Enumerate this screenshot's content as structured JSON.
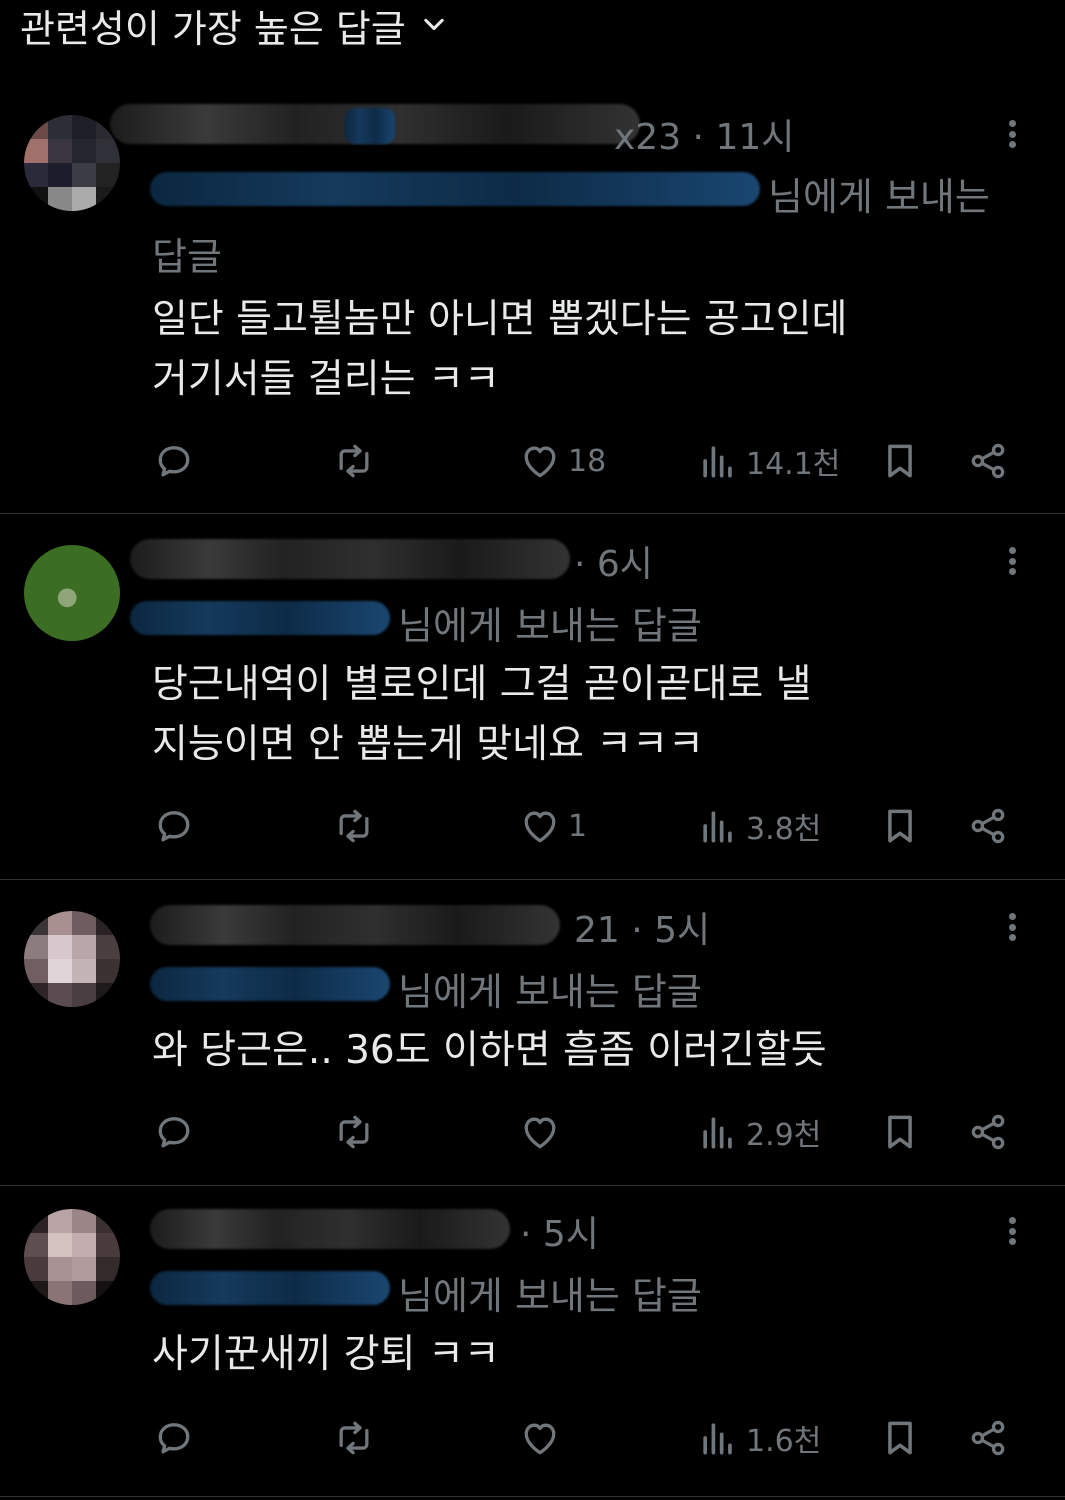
{
  "header": {
    "sort_label": "관련성이 가장 높은 답글"
  },
  "replies": [
    {
      "time_tail": "x23 · 11시",
      "replying_tail": "님에게 보내는",
      "replying_cont": "답글",
      "text_line1": "일단 들고튈놈만 아니면 뽑겠다는 공고인데",
      "text_line2": "거기서들 걸리는 ㅋㅋ",
      "likes": "18",
      "views": "14.1천"
    },
    {
      "time_tail": "· 6시",
      "replying_tail": "님에게 보내는 답글",
      "text_line1": "당근내역이 별로인데 그걸 곧이곧대로 낼",
      "text_line2": "지능이면 안 뽑는게 맞네요 ㅋㅋㅋ",
      "likes": "1",
      "views": "3.8천"
    },
    {
      "time_tail": "21 · 5시",
      "replying_tail": "님에게 보내는 답글",
      "text_line1": "와 당근은.. 36도 이하면 흠좀 이러긴할듯",
      "likes": "",
      "views": "2.9천"
    },
    {
      "time_tail": "· 5시",
      "replying_tail": "님에게 보내는 답글",
      "text_line1": "사기꾼새끼 강퇴 ㅋㅋ",
      "likes": "",
      "views": "1.6천"
    }
  ],
  "colors": {
    "background": "#000000",
    "text_primary": "#e7e9ea",
    "text_secondary": "#71767b",
    "divider": "#2f3336"
  },
  "icons": [
    "chevron-down-icon",
    "more-icon",
    "reply-icon",
    "retweet-icon",
    "like-icon",
    "views-icon",
    "bookmark-icon",
    "share-icon"
  ]
}
